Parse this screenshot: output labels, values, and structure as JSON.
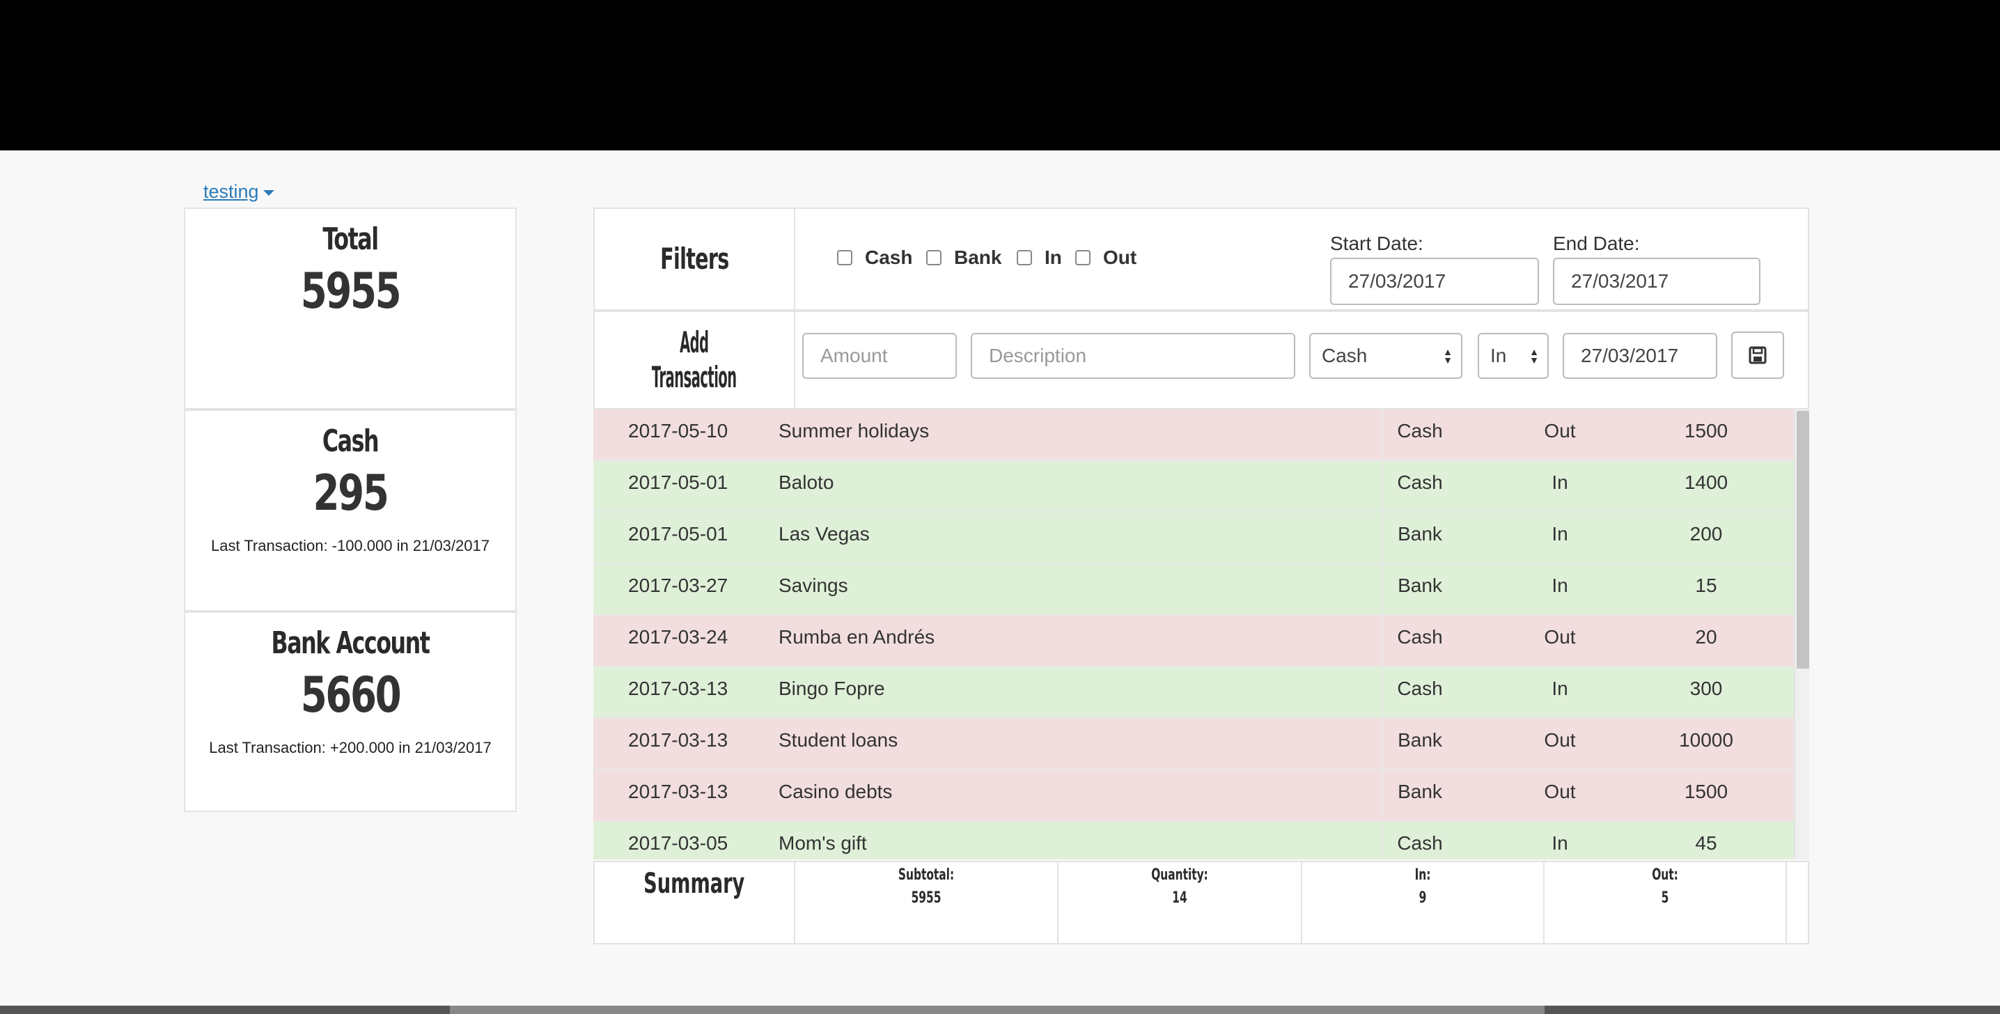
{
  "user": {
    "name": "testing"
  },
  "cards": {
    "total": {
      "title": "Total",
      "value": "5955"
    },
    "cash": {
      "title": "Cash",
      "value": "295",
      "last": "Last Transaction: -100.000 in 21/03/2017"
    },
    "bank": {
      "title": "Bank Account",
      "value": "5660",
      "last": "Last Transaction: +200.000 in 21/03/2017"
    }
  },
  "filters": {
    "title": "Filters",
    "checkboxes": [
      "Cash",
      "Bank",
      "In",
      "Out"
    ],
    "start_label": "Start Date:",
    "start_value": "27/03/2017",
    "end_label": "End Date:",
    "end_value": "27/03/2017"
  },
  "add": {
    "title_line1": "Add",
    "title_line2": "Transaction",
    "amount_placeholder": "Amount",
    "description_placeholder": "Description",
    "account_selected": "Cash",
    "direction_selected": "In",
    "date_value": "27/03/2017",
    "save_icon": "floppy-disk-icon"
  },
  "transactions": [
    {
      "date": "2017-05-10",
      "description": "Summer holidays",
      "account": "Cash",
      "direction": "Out",
      "amount": "1500"
    },
    {
      "date": "2017-05-01",
      "description": "Baloto",
      "account": "Cash",
      "direction": "In",
      "amount": "1400"
    },
    {
      "date": "2017-05-01",
      "description": "Las Vegas",
      "account": "Bank",
      "direction": "In",
      "amount": "200"
    },
    {
      "date": "2017-03-27",
      "description": "Savings",
      "account": "Bank",
      "direction": "In",
      "amount": "15"
    },
    {
      "date": "2017-03-24",
      "description": "Rumba en Andrés",
      "account": "Cash",
      "direction": "Out",
      "amount": "20"
    },
    {
      "date": "2017-03-13",
      "description": "Bingo Fopre",
      "account": "Cash",
      "direction": "In",
      "amount": "300"
    },
    {
      "date": "2017-03-13",
      "description": "Student loans",
      "account": "Bank",
      "direction": "Out",
      "amount": "10000"
    },
    {
      "date": "2017-03-13",
      "description": "Casino debts",
      "account": "Bank",
      "direction": "Out",
      "amount": "1500"
    },
    {
      "date": "2017-03-05",
      "description": "Mom's gift",
      "account": "Cash",
      "direction": "In",
      "amount": "45"
    }
  ],
  "colors": {
    "out_row": "#f2dede",
    "in_row": "#dff0d8",
    "link": "#2a7ab8"
  },
  "summary": {
    "title": "Summary",
    "subtotal_label": "Subtotal:",
    "subtotal_value": "5955",
    "quantity_label": "Quantity:",
    "quantity_value": "14",
    "in_label": "In:",
    "in_value": "9",
    "out_label": "Out:",
    "out_value": "5"
  }
}
